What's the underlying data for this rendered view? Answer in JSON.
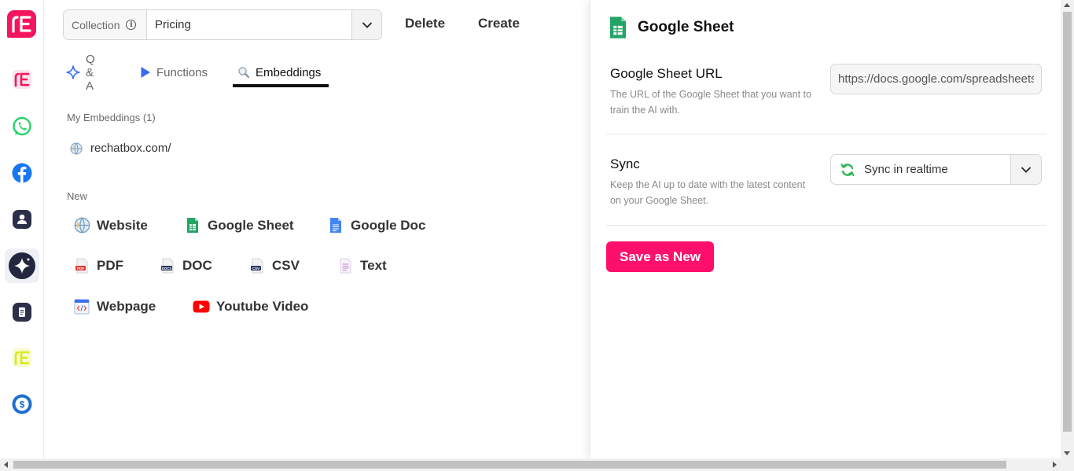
{
  "header": {
    "collection_label": "Collection",
    "collection_value": "Pricing",
    "delete_label": "Delete",
    "create_label": "Create"
  },
  "tabs": [
    {
      "label": "Q & A",
      "icon": "sparkle-icon",
      "active": false
    },
    {
      "label": "Functions",
      "icon": "play-icon",
      "active": false
    },
    {
      "label": "Embeddings",
      "icon": "search-icon",
      "active": true
    }
  ],
  "embeddings": {
    "section_label": "My Embeddings (1)",
    "items": [
      {
        "label": "rechatbox.com/",
        "icon": "globe-icon"
      }
    ]
  },
  "new_sources": {
    "section_label": "New",
    "items": [
      {
        "label": "Website",
        "icon": "globe-icon"
      },
      {
        "label": "Google Sheet",
        "icon": "google-sheet-icon"
      },
      {
        "label": "Google Doc",
        "icon": "google-doc-icon"
      },
      {
        "label": "PDF",
        "icon": "pdf-file-icon"
      },
      {
        "label": "DOC",
        "icon": "doc-file-icon"
      },
      {
        "label": "CSV",
        "icon": "csv-file-icon"
      },
      {
        "label": "Text",
        "icon": "text-file-icon"
      },
      {
        "label": "Webpage",
        "icon": "webpage-icon"
      },
      {
        "label": "Youtube Video",
        "icon": "youtube-icon"
      }
    ]
  },
  "panel": {
    "title": "Google Sheet",
    "url_field": {
      "title": "Google Sheet URL",
      "description": "The URL of the Google Sheet that you want to train the AI with.",
      "value": "https://docs.google.com/spreadsheets/"
    },
    "sync_field": {
      "title": "Sync",
      "description": "Keep the AI up to date with the latest content on your Google Sheet.",
      "value": "Sync in realtime"
    },
    "save_label": "Save as New"
  },
  "sidebar": {
    "items": [
      "rechatbox-icon",
      "whatsapp-icon",
      "facebook-icon",
      "contact-icon",
      "ai-sparkle-icon",
      "document-icon",
      "rechatbox-yellow-icon",
      "billing-icon"
    ],
    "active": "ai-sparkle-icon"
  },
  "colors": {
    "brand": "#f5155d",
    "save_button": "#ff0f6c",
    "whatsapp": "#25d366",
    "facebook": "#1877f2",
    "google_sheet": "#23a566",
    "google_doc": "#4285f4",
    "youtube": "#ff0000",
    "yellow_brand": "#d8e81c"
  }
}
